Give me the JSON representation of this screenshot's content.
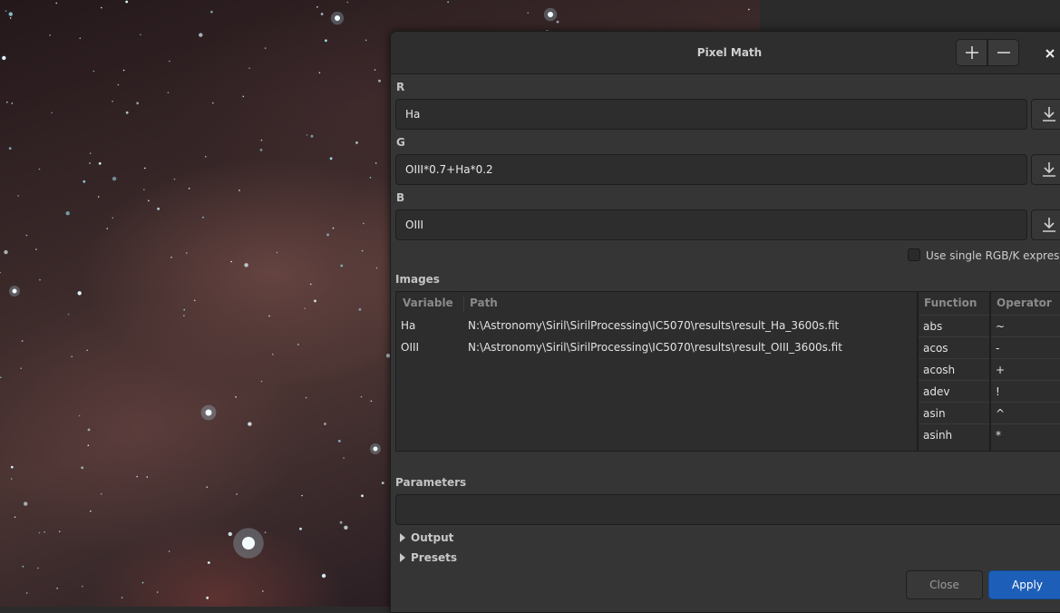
{
  "dialog": {
    "title": "Pixel Math",
    "add_icon": "plus-icon",
    "remove_icon": "minus-icon",
    "close_icon": "close-icon"
  },
  "channels": {
    "r_label": "R",
    "r_value": "Ha",
    "g_label": "G",
    "g_value": "OIII*0.7+Ha*0.2",
    "b_label": "B",
    "b_value": "OIII",
    "download_icon": "download-icon"
  },
  "single_expression": {
    "label": "Use single RGB/K expression",
    "checked": false
  },
  "images": {
    "section_label": "Images",
    "columns": [
      "Variable",
      "Path"
    ],
    "rows": [
      {
        "variable": "Ha",
        "path": "N:\\Astronomy\\Siril\\SirilProcessing\\IC5070\\results\\result_Ha_3600s.fit"
      },
      {
        "variable": "OIII",
        "path": "N:\\Astronomy\\Siril\\SirilProcessing\\IC5070\\results\\result_OIII_3600s.fit"
      }
    ]
  },
  "functions": {
    "header": "Function",
    "items": [
      "abs",
      "acos",
      "acosh",
      "adev",
      "asin",
      "asinh"
    ]
  },
  "operators": {
    "header": "Operator",
    "items": [
      "~",
      "-",
      "+",
      "!",
      "^",
      "*"
    ]
  },
  "parameters": {
    "label": "Parameters",
    "value": ""
  },
  "expanders": {
    "output": "Output",
    "presets": "Presets"
  },
  "buttons": {
    "close": "Close",
    "apply": "Apply"
  },
  "colors": {
    "apply_accent": "#1d5fb8",
    "dialog_bg": "#353535"
  }
}
